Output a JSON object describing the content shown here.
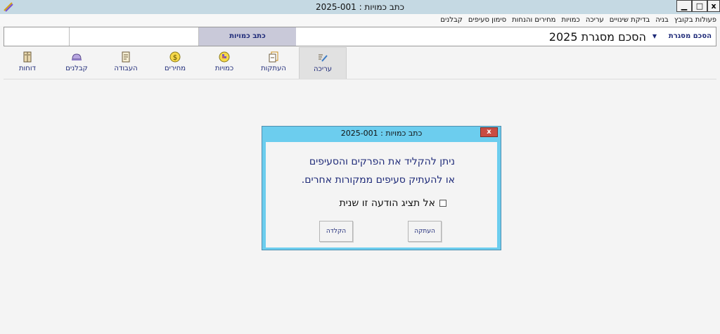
{
  "window": {
    "title": "כתב כמויות : 2025-001",
    "minimize": "▁",
    "maximize": "□",
    "close": "x"
  },
  "menu": {
    "items": [
      "פעולות בקובץ",
      "בניה",
      "בדיקת שינויים",
      "עריכה",
      "כמויות",
      "מחירים והנחות",
      "סימון סעיפים",
      "קבלנים"
    ]
  },
  "header": {
    "tab_label": "הסכם מסגרת",
    "agreement_title": "הסכם מסגרת 2025",
    "active_tab": "כתב כמויות"
  },
  "toolbar": {
    "items": [
      {
        "label": "עריכה",
        "icon": "edit-icon"
      },
      {
        "label": "העתקות",
        "icon": "copy-icon"
      },
      {
        "label": "כמויות",
        "icon": "quantities-icon"
      },
      {
        "label": "מחירים",
        "icon": "dollar-icon"
      },
      {
        "label": "העבודה",
        "icon": "document-icon"
      },
      {
        "label": "קבלנים",
        "icon": "contractor-helmet-icon"
      },
      {
        "label": "דוחות",
        "icon": "reports-book-icon"
      }
    ]
  },
  "dialog": {
    "title": "כתב כמויות : 2025-001",
    "close": "x",
    "message_line1": "ניתן להקליד את הפרקים והסעיפים",
    "message_line2": "או להעתיק סעיפים ממקורות אחרים.",
    "checkbox_label": "אל תציג הודעה זו שנית",
    "checkbox_checked": false,
    "copy_button": "העתקה",
    "type_button": "הקלדה"
  },
  "colors": {
    "titlebar": "#c5d9e3",
    "accent_text": "#1e2a78",
    "dialog_frame": "#6ccdee",
    "close_red": "#c94c42",
    "active_tab": "#c9c9d9"
  }
}
